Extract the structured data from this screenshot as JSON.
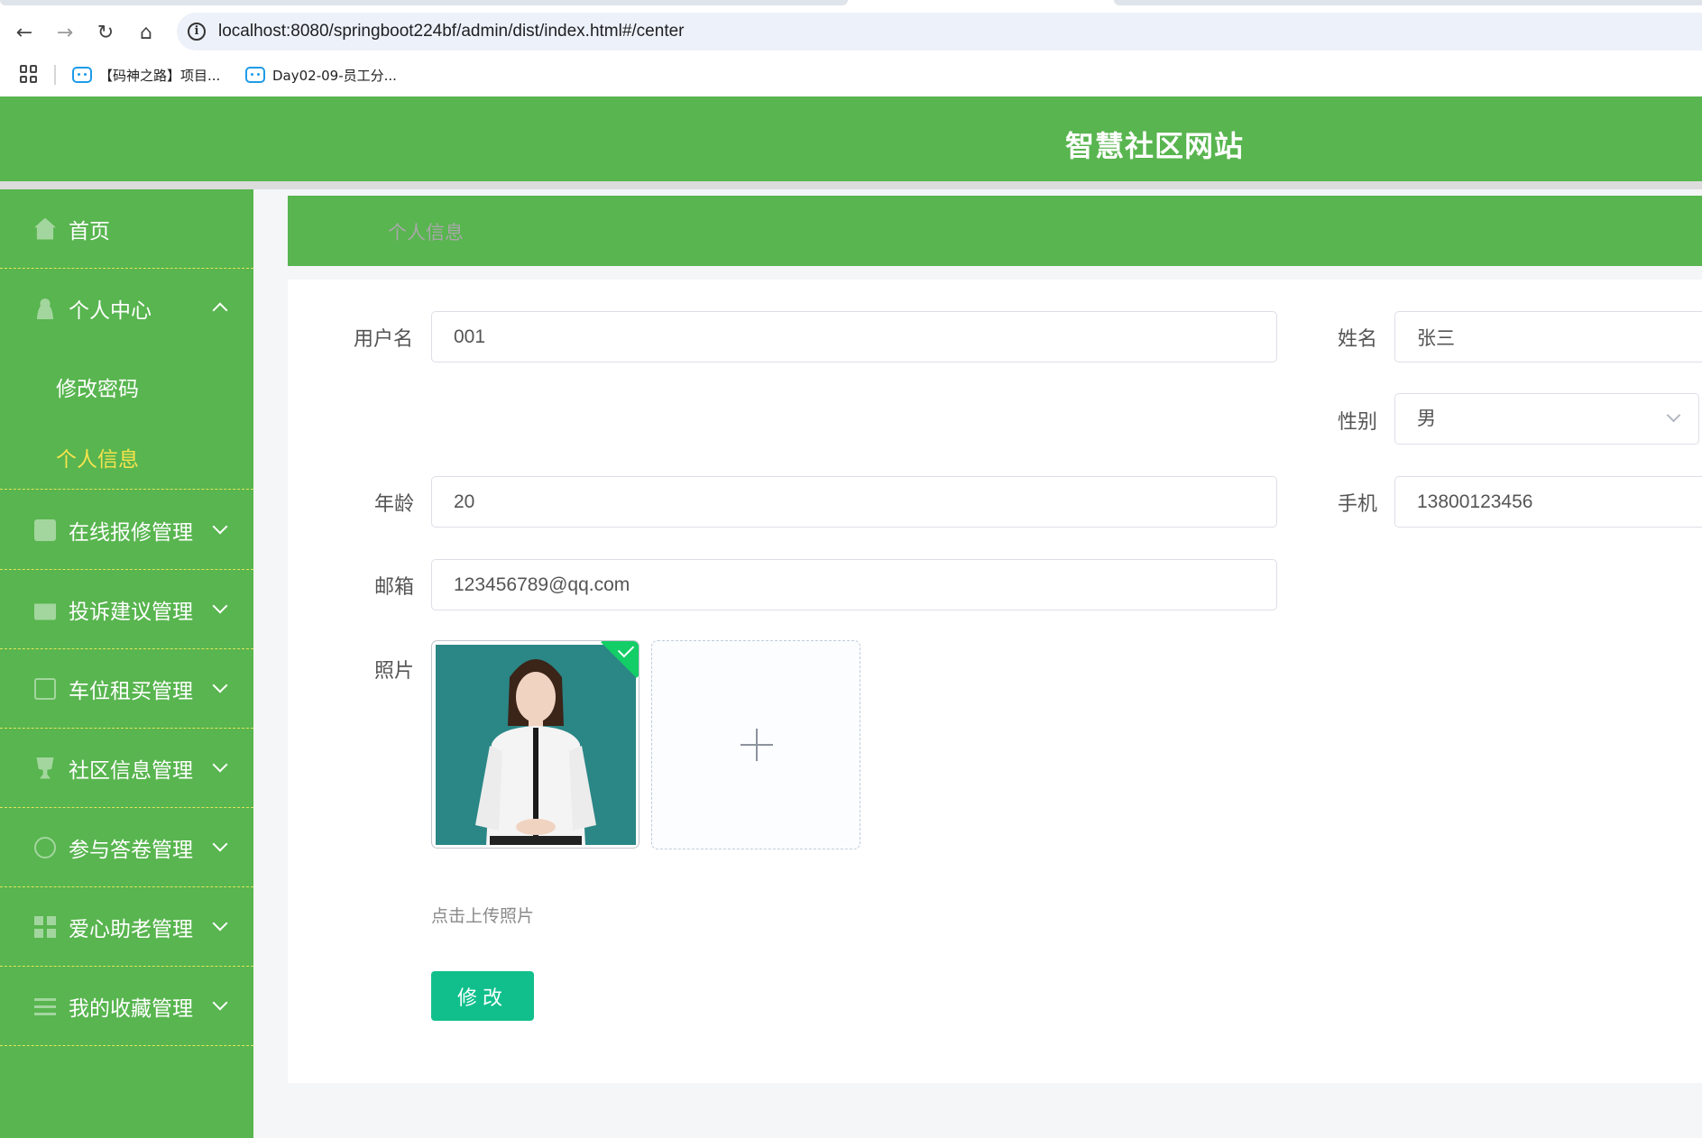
{
  "browser": {
    "url": "localhost:8080/springboot224bf/admin/dist/index.html#/center",
    "bookmarks": [
      {
        "label": "【码神之路】项目..."
      },
      {
        "label": "Day02-09-员工分..."
      }
    ]
  },
  "header": {
    "title": "智慧社区网站"
  },
  "sidebar": {
    "items": [
      {
        "label": "首页",
        "icon": "home-icon"
      },
      {
        "label": "个人中心",
        "icon": "user-icon",
        "expanded": true
      },
      {
        "label": "在线报修管理",
        "icon": "document-icon"
      },
      {
        "label": "投诉建议管理",
        "icon": "briefcase-icon"
      },
      {
        "label": "车位租买管理",
        "icon": "copy-icon"
      },
      {
        "label": "社区信息管理",
        "icon": "trophy-icon"
      },
      {
        "label": "参与答卷管理",
        "icon": "circle-icon"
      },
      {
        "label": "爱心助老管理",
        "icon": "grid-icon"
      },
      {
        "label": "我的收藏管理",
        "icon": "list-icon"
      }
    ],
    "submenu": [
      {
        "label": "修改密码",
        "active": false
      },
      {
        "label": "个人信息",
        "active": true
      }
    ],
    "active_color": "#f5e34d"
  },
  "breadcrumb": {
    "current": "个人信息"
  },
  "form": {
    "username": {
      "label": "用户名",
      "value": "001"
    },
    "name": {
      "label": "姓名",
      "value": "张三"
    },
    "gender": {
      "label": "性别",
      "value": "男"
    },
    "age": {
      "label": "年龄",
      "value": "20"
    },
    "phone": {
      "label": "手机",
      "value": "13800123456"
    },
    "email": {
      "label": "邮箱",
      "value": "123456789@qq.com"
    },
    "photo": {
      "label": "照片",
      "tip": "点击上传照片"
    },
    "submit_label": "修改"
  },
  "colors": {
    "brand_green": "#58b54f",
    "button_green": "#11bf8c",
    "success_badge": "#13ce66"
  }
}
